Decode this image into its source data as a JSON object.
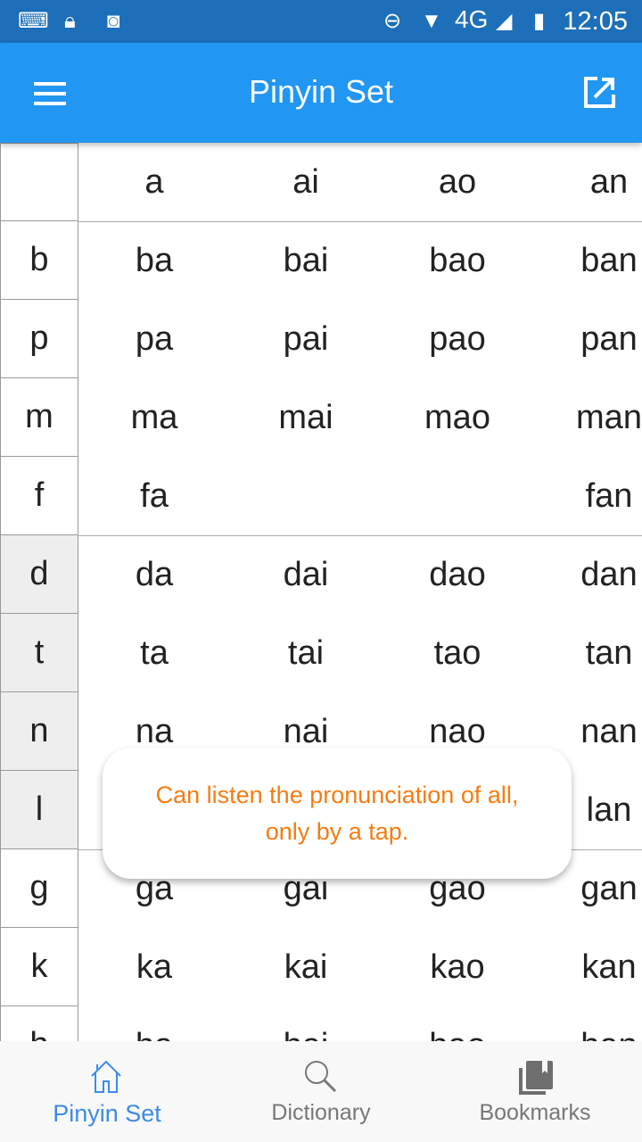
{
  "status_bar": {
    "time": "12:05",
    "network": "4G",
    "icons": [
      "keyboard-icon",
      "lock-icon",
      "android-icon",
      "do-not-disturb-icon",
      "wifi-icon",
      "signal-icon",
      "battery-charging-icon"
    ]
  },
  "app_bar": {
    "title": "Pinyin Set",
    "menu_icon": "menu-icon",
    "action_icon": "open-external-icon"
  },
  "table": {
    "finals": [
      "a",
      "ai",
      "ao",
      "an"
    ],
    "rows": [
      {
        "initial": "b",
        "cells": [
          "ba",
          "bai",
          "bao",
          "ban"
        ]
      },
      {
        "initial": "p",
        "cells": [
          "pa",
          "pai",
          "pao",
          "pan"
        ]
      },
      {
        "initial": "m",
        "cells": [
          "ma",
          "mai",
          "mao",
          "man"
        ]
      },
      {
        "initial": "f",
        "cells": [
          "fa",
          "",
          "",
          "fan"
        ]
      },
      {
        "initial": "d",
        "cells": [
          "da",
          "dai",
          "dao",
          "dan"
        ]
      },
      {
        "initial": "t",
        "cells": [
          "ta",
          "tai",
          "tao",
          "tan"
        ]
      },
      {
        "initial": "n",
        "cells": [
          "na",
          "nai",
          "nao",
          "nan"
        ]
      },
      {
        "initial": "l",
        "cells": [
          "",
          "",
          "",
          "lan"
        ]
      },
      {
        "initial": "g",
        "cells": [
          "ga",
          "gai",
          "gao",
          "gan"
        ]
      },
      {
        "initial": "k",
        "cells": [
          "ka",
          "kai",
          "kao",
          "kan"
        ]
      },
      {
        "initial": "h",
        "cells": [
          "ha",
          "hai",
          "hao",
          "han"
        ]
      }
    ]
  },
  "toast": {
    "line1": "Can listen the pronunciation of all,",
    "line2": "only by a tap."
  },
  "bottom_nav": {
    "items": [
      {
        "label": "Pinyin Set",
        "icon": "home-icon",
        "active": true
      },
      {
        "label": "Dictionary",
        "icon": "search-icon"
      },
      {
        "label": "Bookmarks",
        "icon": "bookmarks-icon"
      }
    ]
  },
  "colors": {
    "primary": "#2196f3",
    "status_bar": "#1c6fb8",
    "toast_text": "#f57c12",
    "active_tab": "#3d8be8",
    "shaded_initial": "#eeeeee"
  }
}
